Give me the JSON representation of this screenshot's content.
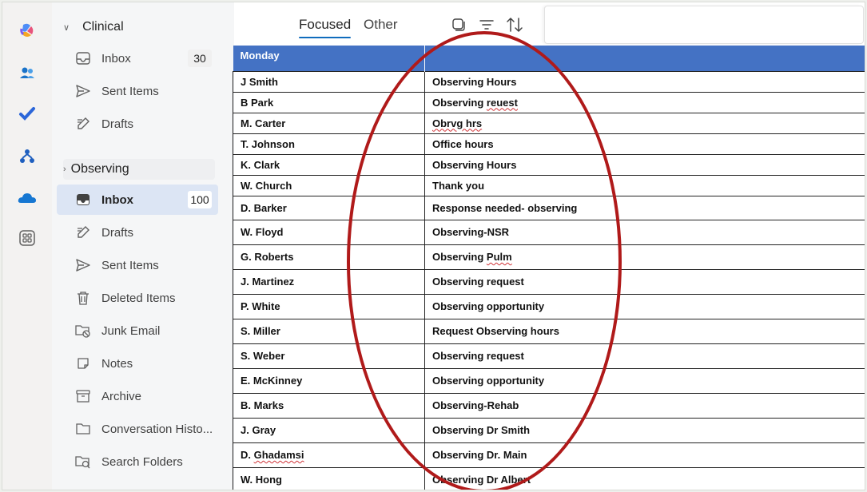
{
  "rail": {
    "icons": [
      "copilot-icon",
      "people-icon",
      "todo-icon",
      "teams-org-icon",
      "onedrive-icon",
      "apps-icon"
    ]
  },
  "folders": {
    "group1": {
      "label": "Clinical"
    },
    "group1_items": [
      {
        "label": "Inbox",
        "count": "30",
        "icon": "inbox-icon"
      },
      {
        "label": "Sent Items",
        "count": "",
        "icon": "send-icon"
      },
      {
        "label": "Drafts",
        "count": "",
        "icon": "drafts-icon"
      }
    ],
    "group2": {
      "label": "Observing"
    },
    "group2_items": [
      {
        "label": "Inbox",
        "count": "100",
        "icon": "inbox-icon",
        "selected": true
      },
      {
        "label": "Drafts",
        "count": "",
        "icon": "drafts-icon"
      },
      {
        "label": "Sent Items",
        "count": "",
        "icon": "send-icon"
      },
      {
        "label": "Deleted Items",
        "count": "",
        "icon": "trash-icon"
      },
      {
        "label": "Junk Email",
        "count": "",
        "icon": "junk-icon"
      },
      {
        "label": "Notes",
        "count": "",
        "icon": "notes-icon"
      },
      {
        "label": "Archive",
        "count": "",
        "icon": "archive-icon"
      },
      {
        "label": "Conversation Histo...",
        "count": "",
        "icon": "folder-icon"
      },
      {
        "label": "Search Folders",
        "count": "",
        "icon": "search-folder-icon"
      }
    ]
  },
  "listhead": {
    "tab_focused": "Focused",
    "tab_other": "Other"
  },
  "table": {
    "header": [
      "Monday",
      ""
    ],
    "rows": [
      [
        "J Smith",
        "Observing Hours"
      ],
      [
        "B Park",
        "Observing reuest"
      ],
      [
        "M. Carter",
        "Obrvg hrs"
      ],
      [
        "T. Johnson",
        "Office hours"
      ],
      [
        "K. Clark",
        "Observing Hours"
      ],
      [
        "W. Church",
        "Thank you"
      ],
      [
        "D. Barker",
        "Response needed- observing"
      ],
      [
        "W. Floyd",
        "Observing-NSR"
      ],
      [
        "G. Roberts",
        "Observing Pulm"
      ],
      [
        "J. Martinez",
        "Observing request"
      ],
      [
        "P. White",
        "Observing opportunity"
      ],
      [
        "S. Miller",
        "Request Observing hours"
      ],
      [
        "S. Weber",
        "Observing request"
      ],
      [
        "E. McKinney",
        "Observing opportunity"
      ],
      [
        "B. Marks",
        "Observing-Rehab"
      ],
      [
        "J. Gray",
        "Observing Dr Smith"
      ],
      [
        "D. Ghadamsi",
        "Observing Dr. Main"
      ],
      [
        "W. Hong",
        "Observing Dr Albert"
      ]
    ]
  },
  "colors": {
    "header_blue": "#4472c4",
    "ellipse_red": "#b01a1a",
    "selected_bg": "#dce5f4"
  }
}
